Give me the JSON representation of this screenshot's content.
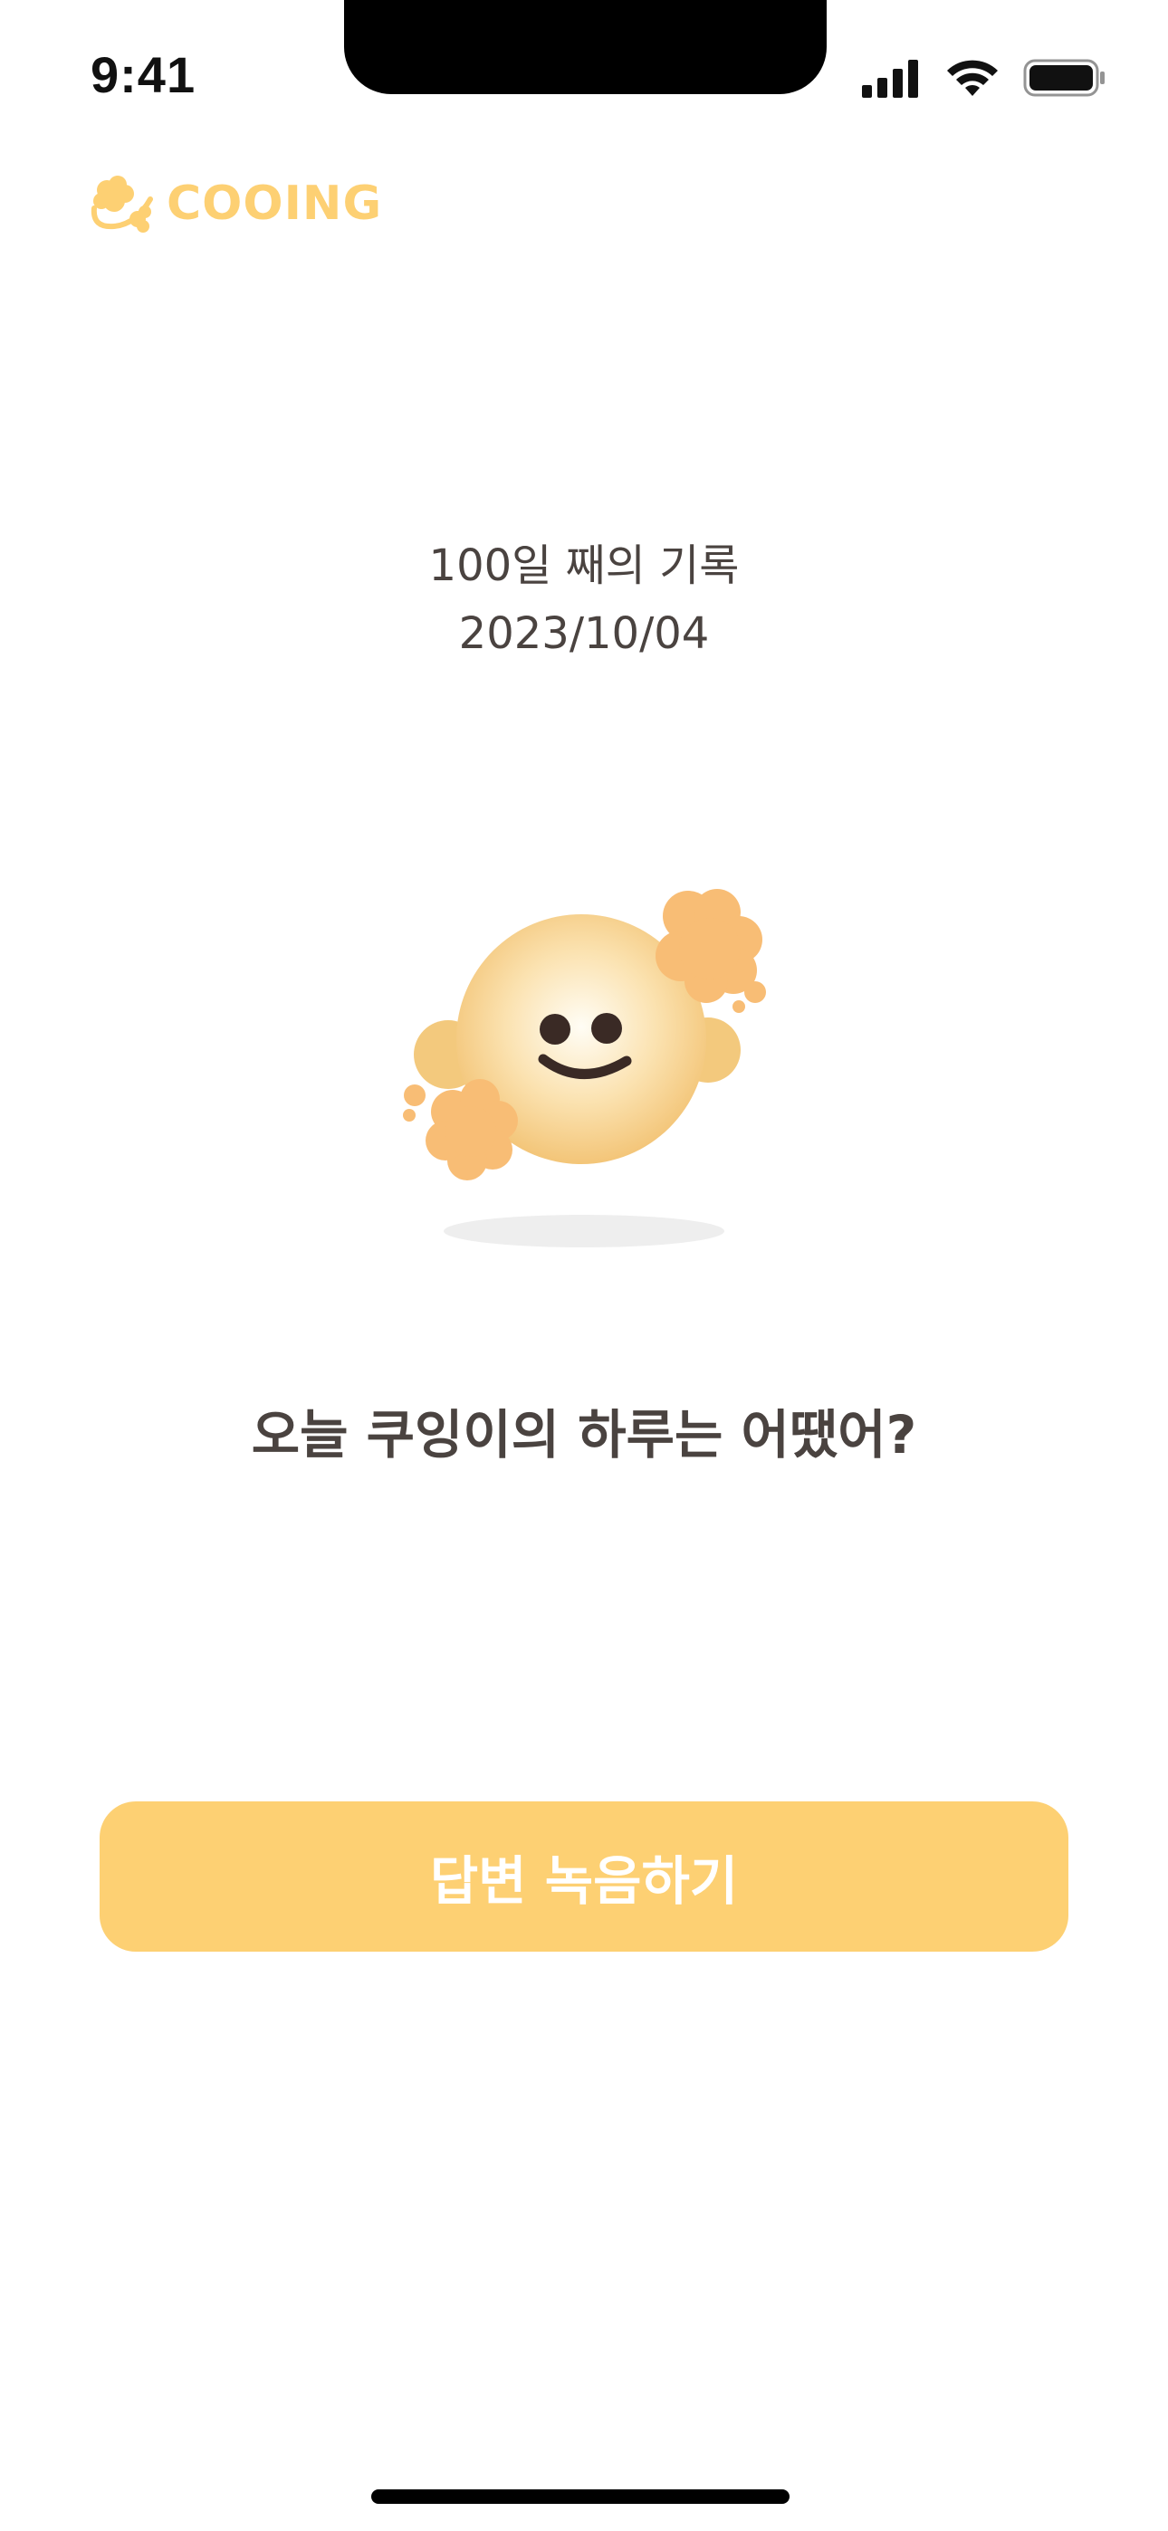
{
  "status_bar": {
    "time": "9:41",
    "icons": [
      "cellular-signal-icon",
      "wifi-icon",
      "battery-icon"
    ]
  },
  "app": {
    "logo_text": "COOING",
    "brand_color": "#fdd073"
  },
  "record": {
    "day_title": "100일 째의 기록",
    "date": "2023/10/04"
  },
  "question": "오늘 쿠잉이의 하루는 어땠어?",
  "actions": {
    "record_answer_label": "답변 녹음하기"
  },
  "colors": {
    "text": "#4a4340",
    "accent": "#fdd073",
    "character_body": "#f6cc85",
    "character_flower": "#f8bd75"
  }
}
